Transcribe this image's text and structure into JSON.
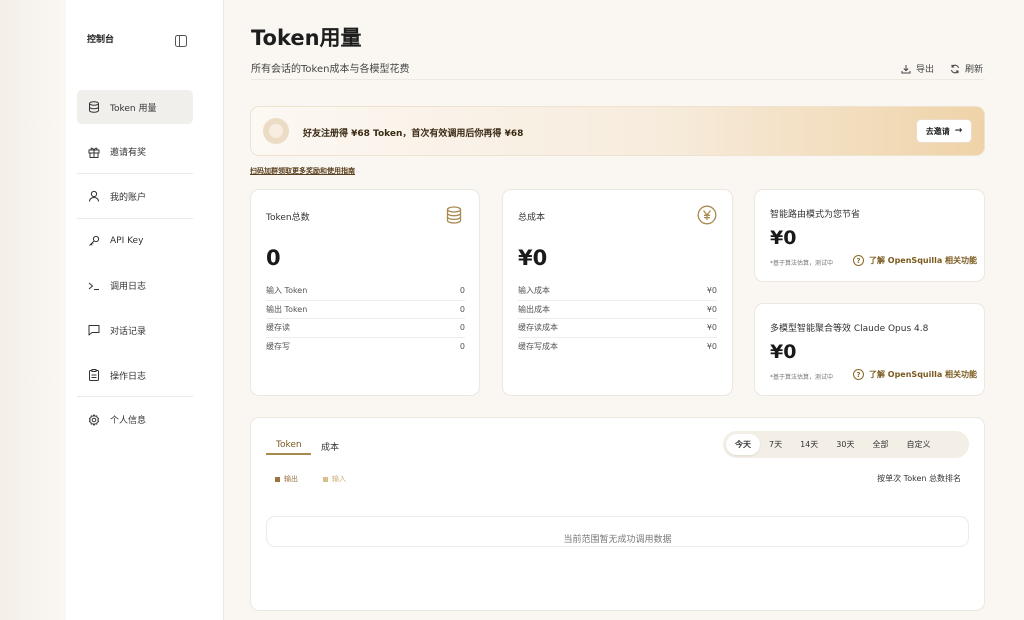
{
  "sidebar": {
    "title": "控制台",
    "items": [
      {
        "label": "Token 用量",
        "icon": "database-icon"
      },
      {
        "label": "邀请有奖",
        "icon": "gift-icon"
      },
      {
        "label": "我的账户",
        "icon": "user-icon"
      },
      {
        "label": "API Key",
        "icon": "key-icon"
      },
      {
        "label": "调用日志",
        "icon": "terminal-icon"
      },
      {
        "label": "对话记录",
        "icon": "chat-icon"
      },
      {
        "label": "操作日志",
        "icon": "clipboard-icon"
      },
      {
        "label": "个人信息",
        "icon": "gear-icon"
      }
    ]
  },
  "header": {
    "title": "Token用量",
    "subtitle": "所有会话的Token成本与各模型花费",
    "export_label": "导出",
    "refresh_label": "刷新"
  },
  "banner": {
    "text": "好友注册得 ¥68 Token，首次有效调用后你再得 ¥68",
    "button_label": "去邀请",
    "guide_link": "扫码加群领取更多奖励和使用指南"
  },
  "token_card": {
    "label": "Token总数",
    "total": "0",
    "rows": [
      {
        "label": "输入 Token",
        "value": "0"
      },
      {
        "label": "输出 Token",
        "value": "0"
      },
      {
        "label": "缓存读",
        "value": "0"
      },
      {
        "label": "缓存写",
        "value": "0"
      }
    ]
  },
  "cost_card": {
    "label": "总成本",
    "total": "¥0",
    "rows": [
      {
        "label": "输入成本",
        "value": "¥0"
      },
      {
        "label": "输出成本",
        "value": "¥0"
      },
      {
        "label": "缓存读成本",
        "value": "¥0"
      },
      {
        "label": "缓存写成本",
        "value": "¥0"
      }
    ]
  },
  "saving_card": {
    "label": "智能路由模式为您节省",
    "value": "¥0",
    "note": "*基于算法估算，测试中",
    "link": "了解 OpenSquilla 相关功能"
  },
  "equiv_card": {
    "label": "多模型智能聚合等效 Claude Opus 4.8",
    "value": "¥0",
    "note": "*基于算法估算，测试中",
    "link": "了解 OpenSquilla 相关功能"
  },
  "panel": {
    "tabs": [
      "Token",
      "成本"
    ],
    "ranges": [
      "今天",
      "7天",
      "14天",
      "30天",
      "全部",
      "自定义"
    ],
    "legend_output": "输出",
    "legend_input": "输入",
    "rank_label": "按单次 Token 总数排名",
    "empty_text": "当前范围暂无成功调用数据"
  },
  "colors": {
    "accent": "#a98a4e",
    "output": "#9a7440",
    "input": "#d8c08c"
  }
}
